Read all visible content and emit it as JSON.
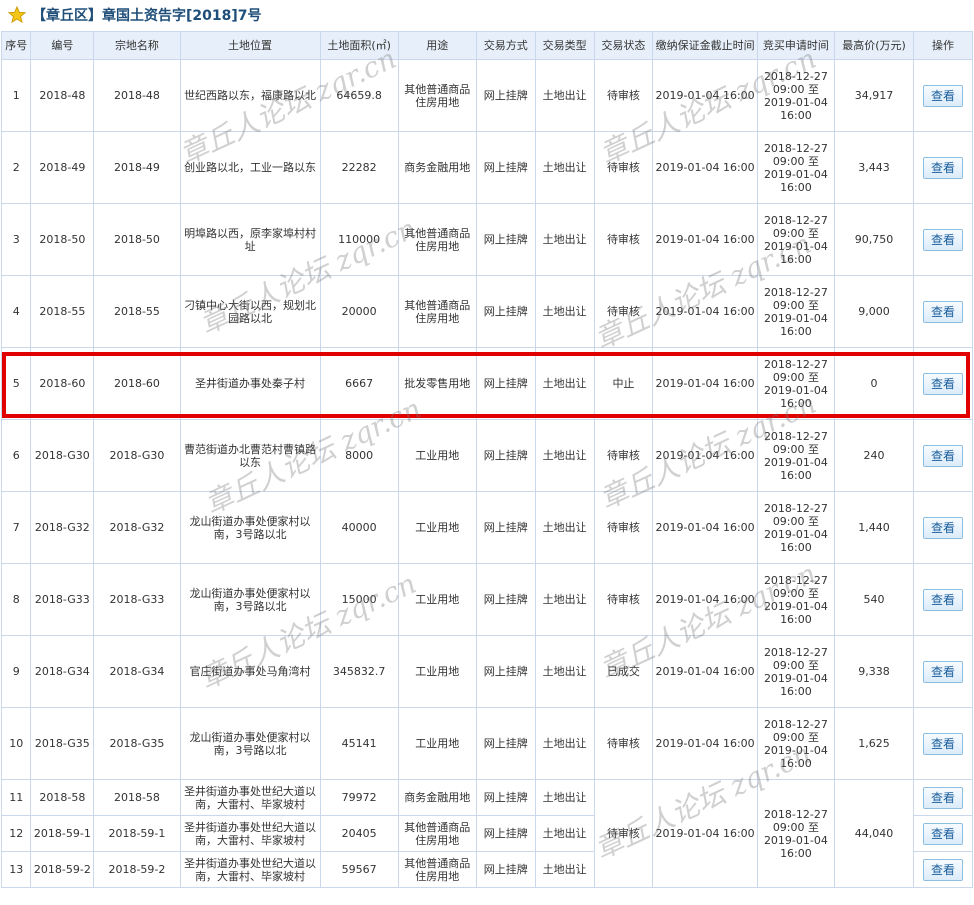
{
  "title": "【章丘区】章国土资告字[2018]7号",
  "headers": [
    "序号",
    "编号",
    "宗地名称",
    "土地位置",
    "土地面积(㎡)",
    "用途",
    "交易方式",
    "交易类型",
    "交易状态",
    "缴纳保证金截止时间",
    "竞买申请时间",
    "最高价(万元)",
    "操作"
  ],
  "view_label": "查看",
  "rows": [
    {
      "no": "1",
      "code": "2018-48",
      "name": "2018-48",
      "loc": "世纪西路以东，福康路以北",
      "area": "64659.8",
      "use": "其他普通商品住房用地",
      "method": "网上挂牌",
      "type": "土地出让",
      "status": "待审核",
      "deposit": "2019-01-04 16:00",
      "apply": [
        "2018-12-27",
        "09:00 至",
        "2019-01-04",
        "16:00"
      ],
      "price": "34,917"
    },
    {
      "no": "2",
      "code": "2018-49",
      "name": "2018-49",
      "loc": "创业路以北，工业一路以东",
      "area": "22282",
      "use": "商务金融用地",
      "method": "网上挂牌",
      "type": "土地出让",
      "status": "待审核",
      "deposit": "2019-01-04 16:00",
      "apply": [
        "2018-12-27",
        "09:00 至",
        "2019-01-04",
        "16:00"
      ],
      "price": "3,443"
    },
    {
      "no": "3",
      "code": "2018-50",
      "name": "2018-50",
      "loc": "明埠路以西，原李家埠村村址",
      "area": "110000",
      "use": "其他普通商品住房用地",
      "method": "网上挂牌",
      "type": "土地出让",
      "status": "待审核",
      "deposit": "2019-01-04 16:00",
      "apply": [
        "2018-12-27",
        "09:00 至",
        "2019-01-04",
        "16:00"
      ],
      "price": "90,750"
    },
    {
      "no": "4",
      "code": "2018-55",
      "name": "2018-55",
      "loc": "刁镇中心大街以西，规划北园路以北",
      "area": "20000",
      "use": "其他普通商品住房用地",
      "method": "网上挂牌",
      "type": "土地出让",
      "status": "待审核",
      "deposit": "2019-01-04 16:00",
      "apply": [
        "2018-12-27",
        "09:00 至",
        "2019-01-04",
        "16:00"
      ],
      "price": "9,000"
    },
    {
      "no": "5",
      "code": "2018-60",
      "name": "2018-60",
      "loc": "圣井街道办事处秦子村",
      "area": "6667",
      "use": "批发零售用地",
      "method": "网上挂牌",
      "type": "土地出让",
      "status": "中止",
      "deposit": "2019-01-04 16:00",
      "apply": [
        "2018-12-27",
        "09:00 至",
        "2019-01-04",
        "16:00"
      ],
      "price": "0"
    },
    {
      "no": "6",
      "code": "2018-G30",
      "name": "2018-G30",
      "loc": "曹范街道办北曹范村曹镇路以东",
      "area": "8000",
      "use": "工业用地",
      "method": "网上挂牌",
      "type": "土地出让",
      "status": "待审核",
      "deposit": "2019-01-04 16:00",
      "apply": [
        "2018-12-27",
        "09:00 至",
        "2019-01-04",
        "16:00"
      ],
      "price": "240"
    },
    {
      "no": "7",
      "code": "2018-G32",
      "name": "2018-G32",
      "loc": "龙山街道办事处便家村以南，3号路以北",
      "area": "40000",
      "use": "工业用地",
      "method": "网上挂牌",
      "type": "土地出让",
      "status": "待审核",
      "deposit": "2019-01-04 16:00",
      "apply": [
        "2018-12-27",
        "09:00 至",
        "2019-01-04",
        "16:00"
      ],
      "price": "1,440"
    },
    {
      "no": "8",
      "code": "2018-G33",
      "name": "2018-G33",
      "loc": "龙山街道办事处便家村以南，3号路以北",
      "area": "15000",
      "use": "工业用地",
      "method": "网上挂牌",
      "type": "土地出让",
      "status": "待审核",
      "deposit": "2019-01-04 16:00",
      "apply": [
        "2018-12-27",
        "09:00 至",
        "2019-01-04",
        "16:00"
      ],
      "price": "540"
    },
    {
      "no": "9",
      "code": "2018-G34",
      "name": "2018-G34",
      "loc": "官庄街道办事处马角湾村",
      "area": "345832.7",
      "use": "工业用地",
      "method": "网上挂牌",
      "type": "土地出让",
      "status": "已成交",
      "deposit": "2019-01-04 16:00",
      "apply": [
        "2018-12-27",
        "09:00 至",
        "2019-01-04",
        "16:00"
      ],
      "price": "9,338"
    },
    {
      "no": "10",
      "code": "2018-G35",
      "name": "2018-G35",
      "loc": "龙山街道办事处便家村以南，3号路以北",
      "area": "45141",
      "use": "工业用地",
      "method": "网上挂牌",
      "type": "土地出让",
      "status": "待审核",
      "deposit": "2019-01-04 16:00",
      "apply": [
        "2018-12-27",
        "09:00 至",
        "2019-01-04",
        "16:00"
      ],
      "price": "1,625"
    }
  ],
  "group_rows": [
    {
      "no": "11",
      "code": "2018-58",
      "name": "2018-58",
      "loc": "圣井街道办事处世纪大道以南，大雷村、毕家坡村",
      "area": "79972",
      "use": "商务金融用地",
      "method": "网上挂牌",
      "type": "土地出让"
    },
    {
      "no": "12",
      "code": "2018-59-1",
      "name": "2018-59-1",
      "loc": "圣井街道办事处世纪大道以南，大雷村、毕家坡村",
      "area": "20405",
      "use": "其他普通商品住房用地",
      "method": "网上挂牌",
      "type": "土地出让"
    },
    {
      "no": "13",
      "code": "2018-59-2",
      "name": "2018-59-2",
      "loc": "圣井街道办事处世纪大道以南，大雷村、毕家坡村",
      "area": "59567",
      "use": "其他普通商品住房用地",
      "method": "网上挂牌",
      "type": "土地出让"
    }
  ],
  "group_shared": {
    "status": "待审核",
    "deposit": "2019-01-04 16:00",
    "apply": [
      "2018-12-27",
      "09:00 至",
      "2019-01-04",
      "16:00"
    ],
    "price": "44,040"
  },
  "watermark_text": "章丘人论坛 zqr.cn",
  "colors": {
    "header_bg": "#e7f0fa",
    "border": "#c9d8ea",
    "title": "#1f4e79",
    "highlight": "#e00000"
  }
}
